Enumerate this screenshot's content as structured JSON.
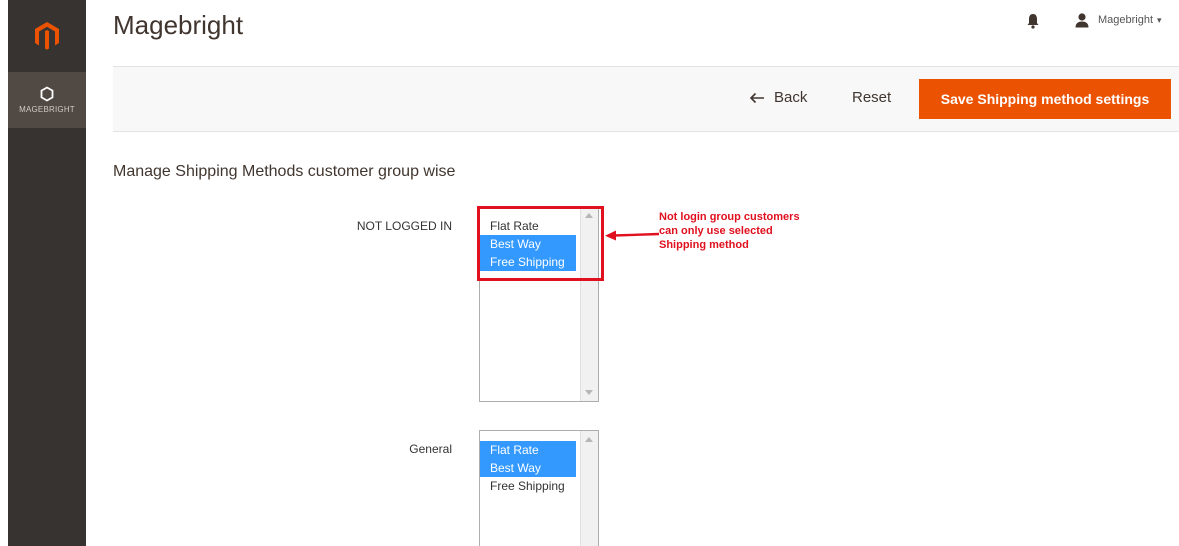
{
  "sidebar": {
    "logo_icon": "magento-logo-icon",
    "item_label": "MAGEBRIGHT",
    "item_icon": "hexagon-icon"
  },
  "header": {
    "title": "Magebright",
    "notifications_icon": "bell-icon",
    "user_name": "Magebright",
    "user_caret": "▾"
  },
  "action_bar": {
    "back_label": "Back",
    "reset_label": "Reset",
    "save_label": "Save Shipping method settings"
  },
  "section": {
    "title": "Manage Shipping Methods customer group wise",
    "groups": [
      {
        "label": "NOT LOGGED IN",
        "options": [
          {
            "label": "Flat Rate",
            "selected": false
          },
          {
            "label": "Best Way",
            "selected": true
          },
          {
            "label": "Free Shipping",
            "selected": true
          }
        ]
      },
      {
        "label": "General",
        "options": [
          {
            "label": "Flat Rate",
            "selected": true
          },
          {
            "label": "Best Way",
            "selected": true
          },
          {
            "label": "Free Shipping",
            "selected": false
          }
        ]
      }
    ]
  },
  "annotation": {
    "line1": "Not login group customers",
    "line2": "can only use selected",
    "line3": "Shipping method"
  },
  "colors": {
    "accent": "#eb5202",
    "sidebar": "#373330",
    "selection": "#3399ff",
    "annotation": "#e0101e"
  }
}
